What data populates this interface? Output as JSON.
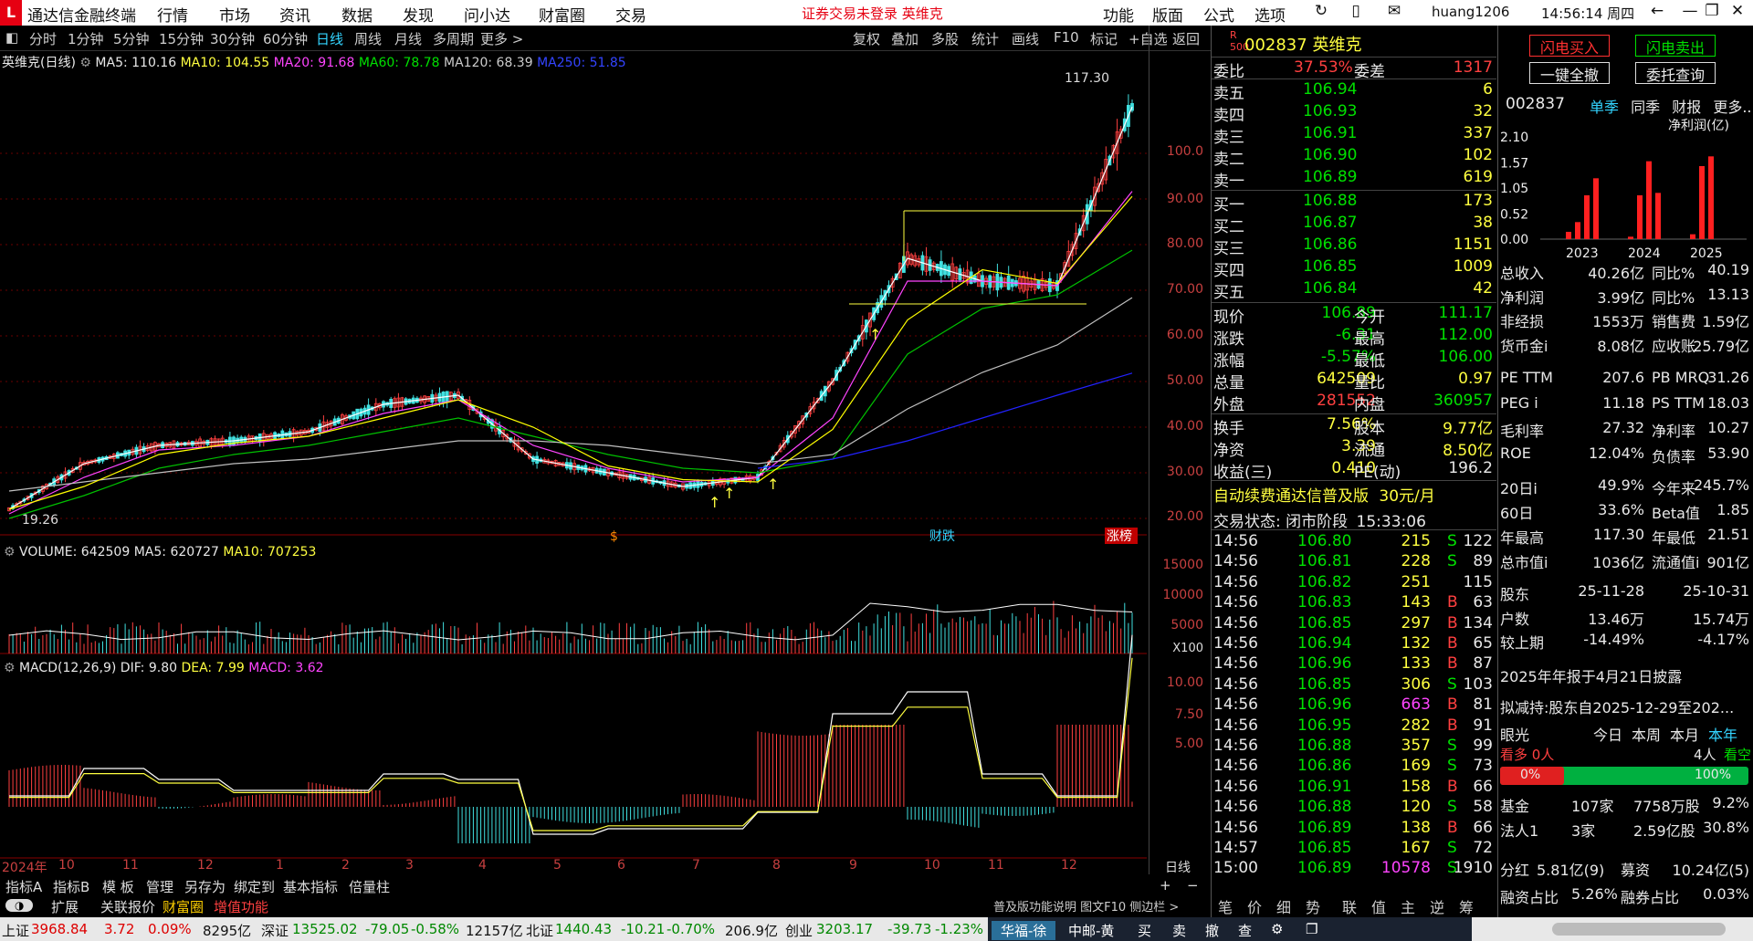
{
  "titlebar": {
    "logo": "L",
    "app_title": "通达信金融终端",
    "menus": [
      "行情",
      "市场",
      "资讯",
      "数据",
      "发现",
      "问小达",
      "财富圈",
      "交易"
    ],
    "warning": "证券交易未登录  英维克",
    "right_menus": [
      "功能",
      "版面",
      "公式",
      "选项"
    ],
    "user": "huang1206",
    "clock": "14:56:14 周四"
  },
  "timeframes": [
    "分时",
    "1分钟",
    "5分钟",
    "15分钟",
    "30分钟",
    "60分钟",
    "日线",
    "周线",
    "月线",
    "多周期",
    "更多 >"
  ],
  "tools": [
    "复权",
    "叠加",
    "多股",
    "统计",
    "画线",
    "F10",
    "标记",
    "+自选",
    "返回"
  ],
  "chart_header": {
    "name": "英维克(日线)",
    "ma5": "MA5: 110.16",
    "ma10": "MA10: 104.55",
    "ma20": "MA20: 91.68",
    "ma60": "MA60: 78.78",
    "ma120": "MA120: 68.39",
    "ma250": "MA250: 51.85"
  },
  "volume_header": {
    "label": "VOLUME: 642509",
    "ma5": "MA5: 620727",
    "ma10": "MA10: 707253"
  },
  "macd_header": {
    "label": "MACD(12,26,9)",
    "dif": "DIF: 9.80",
    "dea": "DEA: 7.99",
    "macd": "MACD: 3.62"
  },
  "price_axis": [
    "100.0",
    "90.00",
    "80.00",
    "70.00",
    "60.00",
    "50.00",
    "40.00",
    "30.00",
    "20.00"
  ],
  "volume_axis": [
    "15000",
    "10000",
    "5000"
  ],
  "volume_unit": "X100",
  "macd_axis": [
    "10.00",
    "7.50",
    "5.00"
  ],
  "date_axis": [
    "2024年",
    "10",
    "11",
    "12",
    "1",
    "2",
    "3",
    "4",
    "5",
    "6",
    "7",
    "8",
    "9",
    "10",
    "11",
    "12"
  ],
  "annotations": {
    "high": "117.30",
    "low": "19.26",
    "marker_s": "$",
    "marker_cai": "财",
    "marker_die": "跌",
    "marker_zhangbang": "涨榜"
  },
  "chart_data": {
    "type": "line",
    "title": "英维克(日线)",
    "ylim": [
      19.26,
      117.3
    ],
    "x": [
      "2024-09",
      "2024-10",
      "2024-11",
      "2024-12",
      "2025-01",
      "2025-02",
      "2025-03",
      "2025-04",
      "2025-05",
      "2025-06",
      "2025-07",
      "2025-08",
      "2025-09",
      "2025-10",
      "2025-11",
      "2025-12"
    ],
    "series": [
      {
        "name": "MA5",
        "values": [
          22,
          32,
          36,
          37,
          39,
          45,
          47,
          33,
          30,
          27,
          29,
          50,
          77,
          72,
          71,
          110.16
        ]
      },
      {
        "name": "MA20",
        "values": [
          21,
          29,
          35,
          36,
          38,
          43,
          46,
          36,
          31,
          28,
          29,
          42,
          72,
          72,
          71,
          91.68
        ]
      },
      {
        "name": "MA60",
        "values": [
          20,
          25,
          31,
          34,
          36,
          39,
          42,
          38,
          34,
          31,
          30,
          33,
          56,
          66,
          69,
          78.78
        ]
      },
      {
        "name": "MA120",
        "values": [
          26,
          28,
          30,
          32,
          33,
          35,
          37,
          37,
          36,
          34,
          32,
          34,
          44,
          52,
          58,
          68.39
        ]
      },
      {
        "name": "MA250",
        "values": [
          null,
          null,
          null,
          null,
          null,
          null,
          null,
          null,
          null,
          null,
          31,
          33,
          37,
          42,
          47,
          51.85
        ]
      }
    ]
  },
  "bottom_tabs1": [
    "指标A",
    "指标B",
    "模 板",
    "管理",
    "另存为",
    "绑定到",
    "基本指标",
    "倍量柱"
  ],
  "bottom_tabs2": [
    "扩展",
    "关联报价",
    "财富圈",
    "增值功能"
  ],
  "bottom_right": "普及版功能说明  图文F10  侧边栏 >",
  "side_tabs": [
    "笔",
    "价",
    "细",
    "势",
    "联",
    "值",
    "主",
    "逆",
    "筹"
  ],
  "quote": {
    "code": "002837",
    "name": "英维克",
    "weibi_label": "委比",
    "weibi": "37.53%",
    "weicha_label": "委差",
    "weicha": "1317",
    "asks": [
      {
        "label": "卖五",
        "price": "106.94",
        "vol": "6"
      },
      {
        "label": "卖四",
        "price": "106.93",
        "vol": "32"
      },
      {
        "label": "卖三",
        "price": "106.91",
        "vol": "337"
      },
      {
        "label": "卖二",
        "price": "106.90",
        "vol": "102"
      },
      {
        "label": "卖一",
        "price": "106.89",
        "vol": "619"
      }
    ],
    "bids": [
      {
        "label": "买一",
        "price": "106.88",
        "vol": "173"
      },
      {
        "label": "买二",
        "price": "106.87",
        "vol": "38"
      },
      {
        "label": "买三",
        "price": "106.86",
        "vol": "1151"
      },
      {
        "label": "买四",
        "price": "106.85",
        "vol": "1009"
      },
      {
        "label": "买五",
        "price": "106.84",
        "vol": "42"
      }
    ],
    "stats": [
      [
        "现价",
        "106.89",
        "今开",
        "111.17"
      ],
      [
        "涨跌",
        "-6.31",
        "最高",
        "112.00"
      ],
      [
        "涨幅",
        "-5.57%",
        "最低",
        "106.00"
      ],
      [
        "总量",
        "642509",
        "量比",
        "0.97"
      ],
      [
        "外盘",
        "281552",
        "内盘",
        "360957"
      ]
    ],
    "stats2": [
      [
        "换手",
        "7.56%",
        "股本",
        "9.77亿"
      ],
      [
        "净资",
        "3.39",
        "流通",
        "8.50亿"
      ],
      [
        "收益(三)",
        "0.410",
        "PE(动)",
        "196.2"
      ]
    ],
    "promo": "自动续费通达信普及版",
    "promo_price": "30元/月",
    "trade_state": "交易状态: 闭市阶段",
    "trade_time": "15:33:06"
  },
  "ticks": [
    [
      "14:56",
      "106.80",
      "215",
      "S",
      "122"
    ],
    [
      "14:56",
      "106.81",
      "228",
      "S",
      "89"
    ],
    [
      "14:56",
      "106.82",
      "251",
      "",
      "115"
    ],
    [
      "14:56",
      "106.83",
      "143",
      "B",
      "63"
    ],
    [
      "14:56",
      "106.85",
      "297",
      "B",
      "134"
    ],
    [
      "14:56",
      "106.94",
      "132",
      "B",
      "65"
    ],
    [
      "14:56",
      "106.96",
      "133",
      "B",
      "87"
    ],
    [
      "14:56",
      "106.85",
      "306",
      "S",
      "103"
    ],
    [
      "14:56",
      "106.96",
      "663",
      "B",
      "81"
    ],
    [
      "14:56",
      "106.95",
      "282",
      "B",
      "91"
    ],
    [
      "14:56",
      "106.88",
      "357",
      "S",
      "99"
    ],
    [
      "14:56",
      "106.86",
      "169",
      "S",
      "73"
    ],
    [
      "14:56",
      "106.91",
      "158",
      "B",
      "66"
    ],
    [
      "14:56",
      "106.88",
      "120",
      "S",
      "58"
    ],
    [
      "14:56",
      "106.89",
      "138",
      "B",
      "66"
    ],
    [
      "14:57",
      "106.85",
      "167",
      "S",
      "72"
    ],
    [
      "15:00",
      "106.89",
      "10578",
      "S",
      "1910"
    ]
  ],
  "fundamentals": {
    "buy_btn": "闪电买入",
    "sell_btn": "闪电卖出",
    "allin_btn": "一键全撤",
    "query_btn": "委托查询",
    "code": "002837",
    "tabs": [
      "单季",
      "同季",
      "财报",
      "更多.."
    ],
    "profit_label": "净利润(亿)",
    "y_axis": [
      "2.10",
      "1.57",
      "1.05",
      "0.52",
      "0.00"
    ],
    "years": [
      "2023",
      "2024",
      "2025"
    ],
    "bars": [
      0.15,
      0.35,
      0.9,
      1.25,
      0.05,
      0.9,
      1.6,
      0.95,
      0.1,
      1.5,
      1.7
    ],
    "rows": [
      [
        "总收入",
        "40.26亿",
        "同比%",
        "40.19"
      ],
      [
        "净利润",
        "3.99亿",
        "同比%",
        "13.13"
      ],
      [
        "非经损",
        "1553万",
        "销售费",
        "1.59亿"
      ],
      [
        "货币金i",
        "8.08亿",
        "应收账",
        "25.79亿"
      ]
    ],
    "rows2": [
      [
        "PE TTM",
        "207.6",
        "PB MRQ",
        "31.26"
      ],
      [
        "PEG i",
        "11.18",
        "PS TTM",
        "18.03"
      ],
      [
        "毛利率",
        "27.32",
        "净利率",
        "10.27"
      ],
      [
        "ROE",
        "12.04%",
        "负债率",
        "53.90"
      ]
    ],
    "rows3": [
      [
        "20日i",
        "49.9%",
        "今年来",
        "245.7%"
      ],
      [
        "60日",
        "33.6%",
        "Beta值",
        "1.85"
      ],
      [
        "年最高",
        "117.30",
        "年最低",
        "21.51"
      ],
      [
        "总市值i",
        "1036亿",
        "流通值i",
        "901亿"
      ]
    ],
    "rows4": [
      [
        "股东",
        "25-11-28",
        "",
        "25-10-31"
      ],
      [
        "户数",
        "13.46万",
        "",
        "15.74万"
      ],
      [
        "较上期",
        "-14.49%",
        "",
        "-4.17%"
      ]
    ],
    "report": "2025年年报于4月21日披露",
    "reduce": "拟减持:股东自2025-12-29至202...",
    "eye_label": "眼光",
    "eye_tabs": [
      "今日",
      "本周",
      "本月",
      "本年"
    ],
    "bull": "看多 0人",
    "bear_count": "4人",
    "bear": "看空",
    "bull_pct": "0%",
    "bear_pct": "100%",
    "inst": [
      [
        "基金",
        "107家",
        "7758万股",
        "9.2%"
      ],
      [
        "法人1",
        "3家",
        "2.59亿股",
        "30.8%"
      ]
    ],
    "fenhong": [
      "分红",
      "5.81亿(9)",
      "募资",
      "10.24亿(5)"
    ],
    "margin": [
      "融资占比",
      "5.26%",
      "融券占比",
      "0.03%"
    ]
  },
  "status": {
    "sh_label": "上证",
    "sh": "3968.84",
    "sh_chg": "3.72",
    "sh_pct": "0.09%",
    "sh_amt": "8295亿",
    "sz_label": "深证",
    "sz": "13525.02",
    "sz_chg": "-79.05",
    "sz_pct": "-0.58%",
    "sz_amt": "12157亿",
    "bz_label": "北证",
    "bz": "1440.43",
    "bz_chg": "-10.21",
    "bz_pct": "-0.70%",
    "bz_amt": "206.9亿",
    "cy_label": "创业",
    "cy": "3203.17",
    "cy_chg": "-39.73",
    "cy_pct": "-1.23%",
    "tabs": [
      "华福-徐",
      "中邮-黄",
      "买",
      "卖",
      "撤",
      "查"
    ]
  },
  "colors": {
    "up": "#ff4040",
    "down": "#00e000",
    "ma5": "#ffffff",
    "ma10": "#ffff00",
    "ma20": "#ff44ff",
    "ma60": "#00c000",
    "ma120": "#c0c0c0",
    "ma250": "#2222ff"
  }
}
